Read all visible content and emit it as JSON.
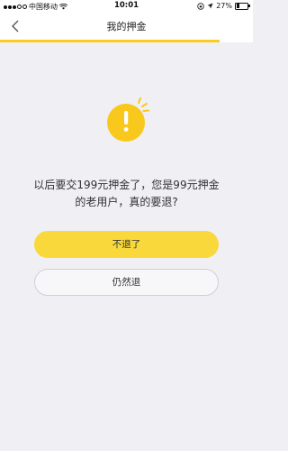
{
  "status_bar": {
    "carrier": "中国移动",
    "time": "10:01",
    "battery": "27%",
    "battery_level": 0.27,
    "signal_bars_filled": 3,
    "signal_bars_total": 5
  },
  "nav": {
    "title": "我的押金",
    "progress_fraction": 0.87,
    "accent_color": "#f9cc1d"
  },
  "dialog": {
    "icon": "exclamation-icon",
    "message_line1": "以后要交199元押金了，您是99元押金",
    "message_line2": "的老用户，真的要退?",
    "primary_button": "不退了",
    "secondary_button": "仍然退",
    "primary_color": "#f8d83a"
  }
}
